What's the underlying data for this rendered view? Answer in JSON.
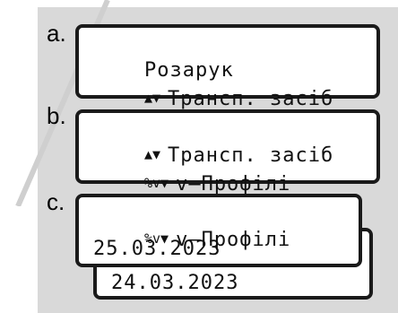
{
  "steps": [
    {
      "label": "a.",
      "lines": [
        {
          "icon": "",
          "text": "Розарук"
        },
        {
          "icon": "▲▼",
          "text": "Трансп. засіб"
        }
      ]
    },
    {
      "label": "b.",
      "lines": [
        {
          "icon": "▲▼",
          "text": "Трансп. засіб"
        },
        {
          "icon": "%v▼",
          "text": "v–Профілі"
        }
      ]
    },
    {
      "label": "c.",
      "lines": [
        {
          "icon": "%v▼",
          "text": "v–Профілі"
        },
        {
          "icon": "",
          "text": "25.03.2023"
        }
      ],
      "back_line": "24.03.2023"
    }
  ],
  "colors": {
    "panel": "#d9d9d9",
    "border": "#1a1a1a",
    "watermark": "#c8c8c8"
  }
}
